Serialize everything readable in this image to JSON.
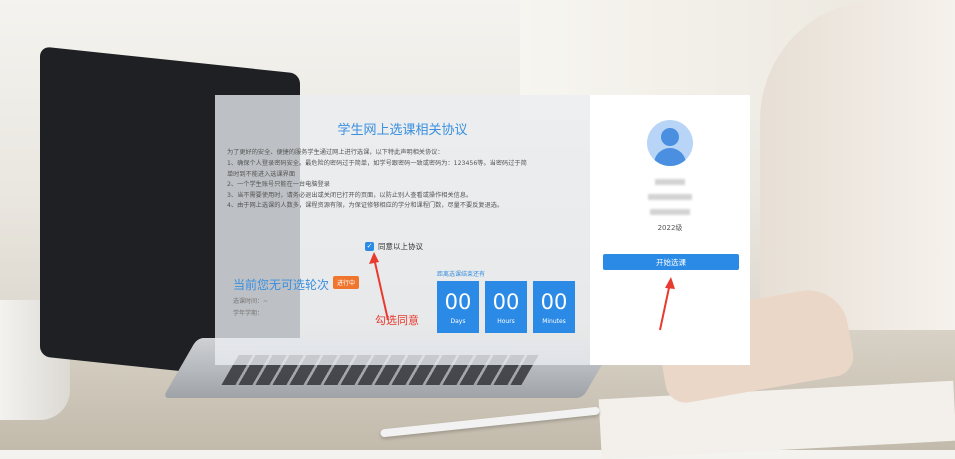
{
  "agreement": {
    "title": "学生网上选课相关协议",
    "intro": "为了更好的安全、便捷的服务学生通过网上进行选课，以下特此声明相关协议：",
    "rules": [
      "1、确保个人登录密码安全。最危险的密码过于简单，如学号跟密码一致或密码为：123456等。当密码过于简",
      "    单时到不能进入选课界面",
      "2、一个学生账号只能在一台电脑登录",
      "3、当不需要使用时，请务必退出或关闭已打开的页面，以防止别人查看或操作相关信息。",
      "4、由于网上选课的人数多，课程资源有限，为保证修够相应的学分和课程门数，尽量不要反复退选。"
    ],
    "agree_label": "同意以上协议",
    "agree_checked": true
  },
  "round": {
    "status_text": "当前您无可选轮次",
    "badge": "进行中",
    "time_label": "选课时间：~",
    "term_label": "学年学期："
  },
  "countdown": {
    "label": "距离选课结束还有",
    "units": [
      {
        "value": "00",
        "label": "Days"
      },
      {
        "value": "00",
        "label": "Hours"
      },
      {
        "value": "00",
        "label": "Minutes"
      }
    ]
  },
  "annotation": {
    "instruction": "勾选同意",
    "arrow_color": "#e83b30"
  },
  "profile": {
    "icon": "user-avatar-icon",
    "grade": "2022级",
    "start_button": "开始选课"
  },
  "colors": {
    "accent": "#2b8ae6",
    "title": "#3a8fe0",
    "badge": "#f0762e"
  }
}
